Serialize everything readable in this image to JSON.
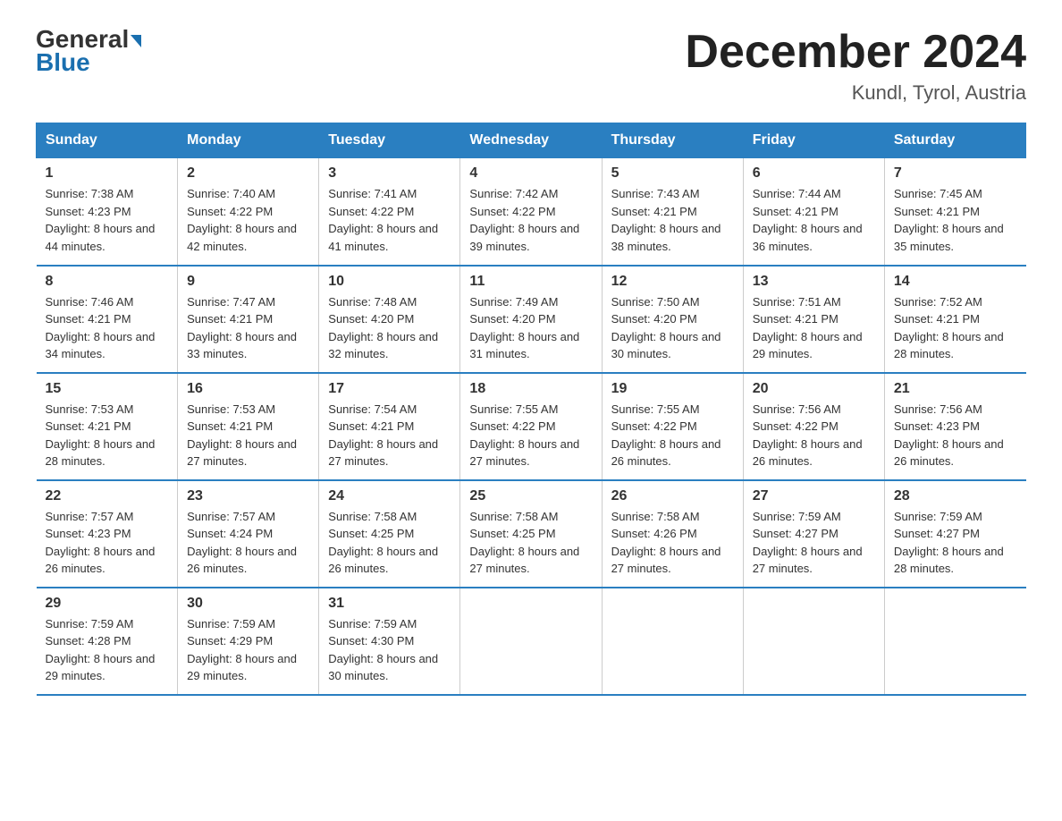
{
  "header": {
    "logo_general": "General",
    "logo_blue": "Blue",
    "month_title": "December 2024",
    "location": "Kundl, Tyrol, Austria"
  },
  "days_of_week": [
    "Sunday",
    "Monday",
    "Tuesday",
    "Wednesday",
    "Thursday",
    "Friday",
    "Saturday"
  ],
  "weeks": [
    [
      {
        "day": "1",
        "sunrise": "7:38 AM",
        "sunset": "4:23 PM",
        "daylight": "8 hours and 44 minutes."
      },
      {
        "day": "2",
        "sunrise": "7:40 AM",
        "sunset": "4:22 PM",
        "daylight": "8 hours and 42 minutes."
      },
      {
        "day": "3",
        "sunrise": "7:41 AM",
        "sunset": "4:22 PM",
        "daylight": "8 hours and 41 minutes."
      },
      {
        "day": "4",
        "sunrise": "7:42 AM",
        "sunset": "4:22 PM",
        "daylight": "8 hours and 39 minutes."
      },
      {
        "day": "5",
        "sunrise": "7:43 AM",
        "sunset": "4:21 PM",
        "daylight": "8 hours and 38 minutes."
      },
      {
        "day": "6",
        "sunrise": "7:44 AM",
        "sunset": "4:21 PM",
        "daylight": "8 hours and 36 minutes."
      },
      {
        "day": "7",
        "sunrise": "7:45 AM",
        "sunset": "4:21 PM",
        "daylight": "8 hours and 35 minutes."
      }
    ],
    [
      {
        "day": "8",
        "sunrise": "7:46 AM",
        "sunset": "4:21 PM",
        "daylight": "8 hours and 34 minutes."
      },
      {
        "day": "9",
        "sunrise": "7:47 AM",
        "sunset": "4:21 PM",
        "daylight": "8 hours and 33 minutes."
      },
      {
        "day": "10",
        "sunrise": "7:48 AM",
        "sunset": "4:20 PM",
        "daylight": "8 hours and 32 minutes."
      },
      {
        "day": "11",
        "sunrise": "7:49 AM",
        "sunset": "4:20 PM",
        "daylight": "8 hours and 31 minutes."
      },
      {
        "day": "12",
        "sunrise": "7:50 AM",
        "sunset": "4:20 PM",
        "daylight": "8 hours and 30 minutes."
      },
      {
        "day": "13",
        "sunrise": "7:51 AM",
        "sunset": "4:21 PM",
        "daylight": "8 hours and 29 minutes."
      },
      {
        "day": "14",
        "sunrise": "7:52 AM",
        "sunset": "4:21 PM",
        "daylight": "8 hours and 28 minutes."
      }
    ],
    [
      {
        "day": "15",
        "sunrise": "7:53 AM",
        "sunset": "4:21 PM",
        "daylight": "8 hours and 28 minutes."
      },
      {
        "day": "16",
        "sunrise": "7:53 AM",
        "sunset": "4:21 PM",
        "daylight": "8 hours and 27 minutes."
      },
      {
        "day": "17",
        "sunrise": "7:54 AM",
        "sunset": "4:21 PM",
        "daylight": "8 hours and 27 minutes."
      },
      {
        "day": "18",
        "sunrise": "7:55 AM",
        "sunset": "4:22 PM",
        "daylight": "8 hours and 27 minutes."
      },
      {
        "day": "19",
        "sunrise": "7:55 AM",
        "sunset": "4:22 PM",
        "daylight": "8 hours and 26 minutes."
      },
      {
        "day": "20",
        "sunrise": "7:56 AM",
        "sunset": "4:22 PM",
        "daylight": "8 hours and 26 minutes."
      },
      {
        "day": "21",
        "sunrise": "7:56 AM",
        "sunset": "4:23 PM",
        "daylight": "8 hours and 26 minutes."
      }
    ],
    [
      {
        "day": "22",
        "sunrise": "7:57 AM",
        "sunset": "4:23 PM",
        "daylight": "8 hours and 26 minutes."
      },
      {
        "day": "23",
        "sunrise": "7:57 AM",
        "sunset": "4:24 PM",
        "daylight": "8 hours and 26 minutes."
      },
      {
        "day": "24",
        "sunrise": "7:58 AM",
        "sunset": "4:25 PM",
        "daylight": "8 hours and 26 minutes."
      },
      {
        "day": "25",
        "sunrise": "7:58 AM",
        "sunset": "4:25 PM",
        "daylight": "8 hours and 27 minutes."
      },
      {
        "day": "26",
        "sunrise": "7:58 AM",
        "sunset": "4:26 PM",
        "daylight": "8 hours and 27 minutes."
      },
      {
        "day": "27",
        "sunrise": "7:59 AM",
        "sunset": "4:27 PM",
        "daylight": "8 hours and 27 minutes."
      },
      {
        "day": "28",
        "sunrise": "7:59 AM",
        "sunset": "4:27 PM",
        "daylight": "8 hours and 28 minutes."
      }
    ],
    [
      {
        "day": "29",
        "sunrise": "7:59 AM",
        "sunset": "4:28 PM",
        "daylight": "8 hours and 29 minutes."
      },
      {
        "day": "30",
        "sunrise": "7:59 AM",
        "sunset": "4:29 PM",
        "daylight": "8 hours and 29 minutes."
      },
      {
        "day": "31",
        "sunrise": "7:59 AM",
        "sunset": "4:30 PM",
        "daylight": "8 hours and 30 minutes."
      },
      null,
      null,
      null,
      null
    ]
  ],
  "labels": {
    "sunrise_prefix": "Sunrise: ",
    "sunset_prefix": "Sunset: ",
    "daylight_prefix": "Daylight: "
  }
}
